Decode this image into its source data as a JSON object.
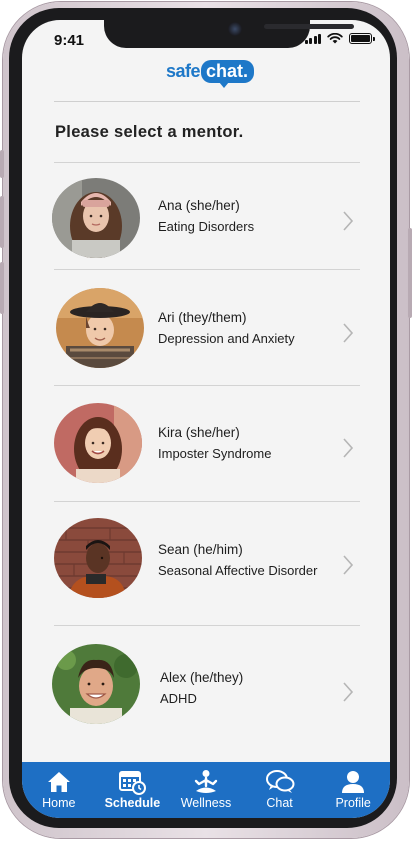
{
  "status_bar": {
    "time": "9:41"
  },
  "logo": {
    "part1": "safe",
    "part2": "chat."
  },
  "heading": "Please select a mentor.",
  "mentors": [
    {
      "name": "Ana (she/her)",
      "topic": "Eating Disorders"
    },
    {
      "name": "Ari (they/them)",
      "topic": "Depression and Anxiety"
    },
    {
      "name": "Kira (she/her)",
      "topic": "Imposter Syndrome"
    },
    {
      "name": "Sean (he/him)",
      "topic": "Seasonal Affective Disorder"
    },
    {
      "name": "Alex (he/they)",
      "topic": "ADHD"
    }
  ],
  "tabbar": {
    "items": [
      {
        "label": "Home",
        "icon": "home-icon",
        "active": false
      },
      {
        "label": "Schedule",
        "icon": "calendar-clock-icon",
        "active": true
      },
      {
        "label": "Wellness",
        "icon": "meditation-icon",
        "active": false
      },
      {
        "label": "Chat",
        "icon": "chat-bubbles-icon",
        "active": false
      },
      {
        "label": "Profile",
        "icon": "person-icon",
        "active": false
      }
    ]
  },
  "colors": {
    "brand_blue": "#1e78c8",
    "tabbar_blue": "#1e6fc4",
    "screen_bg": "#f4f4f4"
  }
}
